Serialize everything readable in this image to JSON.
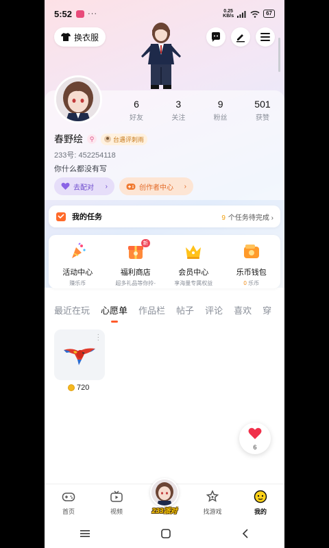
{
  "status_bar": {
    "time": "5:52",
    "dots": "···",
    "net_speed_value": "0.25",
    "net_speed_unit": "KB/s",
    "battery": "67"
  },
  "header": {
    "outfit_button": "换衣服",
    "icons": [
      "chat-icon",
      "edit-icon",
      "menu-icon"
    ]
  },
  "profile": {
    "name": "春野绘",
    "review_tag": "台遇评刺雨",
    "uid_label": "233号:",
    "uid": "452254118",
    "bio": "你什么都没有写",
    "stats": [
      {
        "num": "6",
        "label": "好友"
      },
      {
        "num": "3",
        "label": "关注"
      },
      {
        "num": "9",
        "label": "粉丝"
      },
      {
        "num": "501",
        "label": "获赞"
      }
    ],
    "match_button": "去配对",
    "creator_button": "创作者中心"
  },
  "tasks": {
    "title": "我的任务",
    "pending_count": "9",
    "pending_text": "个任务待完成"
  },
  "grid": [
    {
      "title": "活动中心",
      "sub": "赚乐币",
      "icon": "party-popper-icon"
    },
    {
      "title": "福利商店",
      "sub": "超多礼品等你拎-",
      "icon": "gift-shop-icon",
      "badge": "新"
    },
    {
      "title": "会员中心",
      "sub": "享海量专属权益",
      "icon": "crown-icon"
    },
    {
      "title": "乐币钱包",
      "sub_num": "0",
      "sub": "乐币",
      "icon": "wallet-icon"
    }
  ],
  "tabs": [
    "最近在玩",
    "心愿单",
    "作品栏",
    "帖子",
    "评论",
    "喜欢",
    "穿"
  ],
  "active_tab": 1,
  "wishlist": [
    {
      "price": "720",
      "icon": "parrot-icon"
    }
  ],
  "like_float": {
    "count": "6"
  },
  "bottom_nav": [
    {
      "label": "首页",
      "icon": "gamepad-icon"
    },
    {
      "label": "视频",
      "icon": "tv-icon"
    },
    {
      "label": "233派对",
      "icon": "avatar"
    },
    {
      "label": "找游戏",
      "icon": "star-search-icon"
    },
    {
      "label": "我的",
      "icon": "face-icon"
    }
  ],
  "colors": {
    "accent_orange": "#ff5a2a",
    "purple": "#6a47cc",
    "creator_orange": "#e36a27"
  }
}
